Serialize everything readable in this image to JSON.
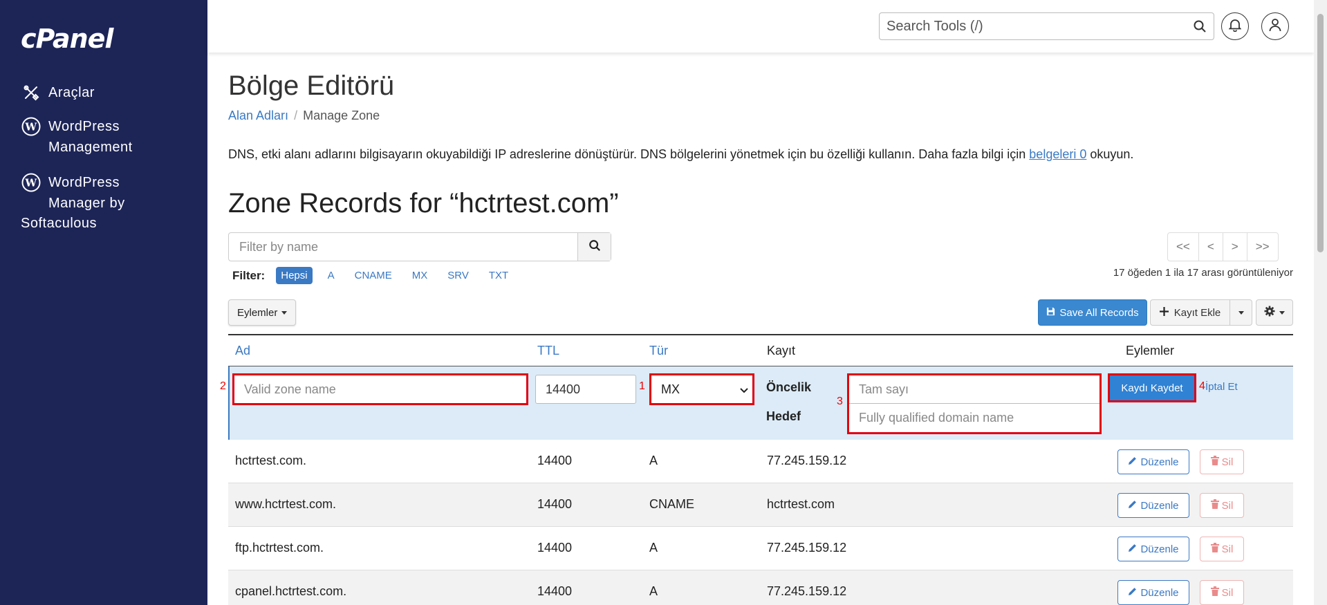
{
  "sidebar": {
    "logo": "cPanel",
    "items": [
      {
        "label": "Araçlar"
      },
      {
        "label": "WordPress\nManagement"
      },
      {
        "label": "WordPress\nManager by"
      }
    ],
    "extra_line": "Softaculous"
  },
  "header": {
    "search_placeholder": "Search Tools (/)"
  },
  "page": {
    "title": "Bölge Editörü",
    "breadcrumb": {
      "parent": "Alan Adları",
      "separator": "/",
      "current": "Manage Zone"
    },
    "description_prefix": "DNS, etki alanı adlarını bilgisayarın okuyabildiği IP adreslerine dönüştürür. DNS bölgelerini yönetmek için bu özelliği kullanın. Daha fazla bilgi için ",
    "description_link": "belgeleri 0",
    "description_suffix": " okuyun.",
    "zone_title": "Zone Records for “hctrtest.com”"
  },
  "filter": {
    "placeholder": "Filter by name",
    "label": "Filter:",
    "chips": [
      "Hepsi",
      "A",
      "CNAME",
      "MX",
      "SRV",
      "TXT"
    ],
    "active": "Hepsi"
  },
  "pager": {
    "first": "<<",
    "prev": "<",
    "next": ">",
    "last": ">>",
    "info": "17 öğeden 1 ila 17 arası görüntüleniyor"
  },
  "toolbar": {
    "actions_label": "Eylemler",
    "save_all_label": "Save All Records",
    "add_record_label": "Kayıt Ekle"
  },
  "table": {
    "headers": {
      "name": "Ad",
      "ttl": "TTL",
      "type": "Tür",
      "record": "Kayıt",
      "actions": "Eylemler"
    }
  },
  "edit_row": {
    "name_placeholder": "Valid zone name",
    "ttl_value": "14400",
    "type_value": "MX",
    "priority_label": "Öncelik",
    "target_label": "Hedef",
    "priority_placeholder": "Tam sayı",
    "target_placeholder": "Fully qualified domain name",
    "save_label": "Kaydı Kaydet",
    "cancel_label": "İptal Et",
    "marker_1": "1",
    "marker_2": "2",
    "marker_3": "3",
    "marker_4": "4"
  },
  "records": [
    {
      "name": "hctrtest.com.",
      "ttl": "14400",
      "type": "A",
      "record": "77.245.159.12"
    },
    {
      "name": "www.hctrtest.com.",
      "ttl": "14400",
      "type": "CNAME",
      "record": "hctrtest.com"
    },
    {
      "name": "ftp.hctrtest.com.",
      "ttl": "14400",
      "type": "A",
      "record": "77.245.159.12"
    },
    {
      "name": "cpanel.hctrtest.com.",
      "ttl": "14400",
      "type": "A",
      "record": "77.245.159.12"
    }
  ],
  "row_actions": {
    "edit_label": "Düzenle",
    "delete_label": "Sil"
  },
  "colors": {
    "sidebar": "#1d2557",
    "accent": "#3a79c4",
    "highlight": "#e00010",
    "edit_row": "#dcebf7"
  }
}
